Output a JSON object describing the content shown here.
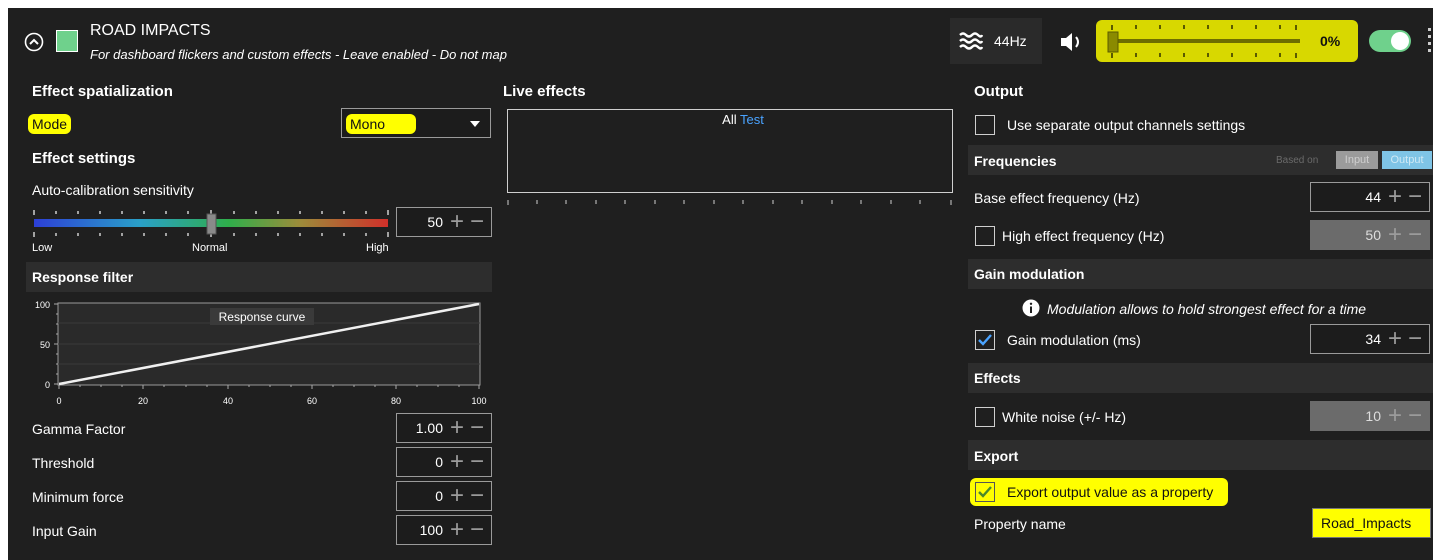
{
  "header": {
    "title": "ROAD IMPACTS",
    "subtitle": "For dashboard flickers and custom effects - Leave enabled - Do not map",
    "frequency_badge": "44Hz",
    "volume_percent": "0%",
    "volume_level": 0,
    "accent_color": "#6fd18c",
    "toggle_on": true
  },
  "spatialization": {
    "heading": "Effect spatialization",
    "mode_label": "Mode",
    "mode_value": "Mono"
  },
  "effect_settings": {
    "heading": "Effect settings",
    "calibration_label": "Auto-calibration sensitivity",
    "slider_low": "Low",
    "slider_normal": "Normal",
    "slider_high": "High",
    "calibration_value": "50",
    "response_filter_heading": "Response filter",
    "response_curve_label": "Response curve",
    "curve_y_ticks": [
      "100",
      "50",
      "0"
    ],
    "curve_x_ticks": [
      "0",
      "20",
      "40",
      "60",
      "80",
      "100"
    ],
    "gamma_label": "Gamma Factor",
    "gamma_value": "1.00",
    "threshold_label": "Threshold",
    "threshold_value": "0",
    "min_force_label": "Minimum force",
    "min_force_value": "0",
    "input_gain_label": "Input Gain",
    "input_gain_value": "100"
  },
  "live_effects": {
    "heading": "Live effects",
    "filter_all": "All",
    "filter_test": "Test"
  },
  "output": {
    "heading": "Output",
    "separate_channels_label": "Use separate output channels settings",
    "frequencies_heading": "Frequencies",
    "based_on_label": "Based on",
    "based_on_input": "Input",
    "based_on_output": "Output",
    "base_freq_label": "Base effect frequency (Hz)",
    "base_freq_value": "44",
    "high_freq_label": "High effect frequency (Hz)",
    "high_freq_value": "50",
    "gain_mod_heading": "Gain modulation",
    "gain_mod_info": "Modulation allows to hold strongest effect for a time",
    "gain_mod_label": "Gain modulation (ms)",
    "gain_mod_value": "34",
    "effects_heading": "Effects",
    "white_noise_label": "White noise (+/- Hz)",
    "white_noise_value": "10",
    "export_heading": "Export",
    "export_checkbox_label": "Export output value as a property",
    "property_name_label": "Property name",
    "property_name_value": "Road_Impacts"
  }
}
